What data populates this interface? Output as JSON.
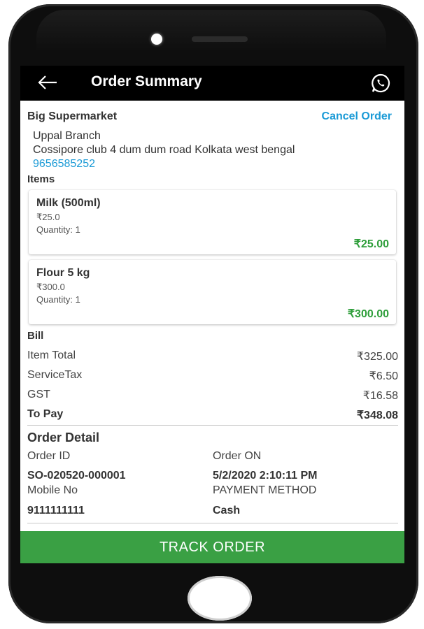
{
  "appbar": {
    "title": "Order Summary"
  },
  "store": {
    "name": "Big Supermarket",
    "cancel_label": "Cancel Order",
    "branch": "Uppal Branch",
    "address": "Cossipore club 4 dum dum road Kolkata west bengal",
    "phone": "9656585252"
  },
  "items_title": "Items",
  "items": [
    {
      "name": "Milk (500ml)",
      "price": "₹25.0",
      "quantity": "Quantity: 1",
      "total": "₹25.00"
    },
    {
      "name": "Flour 5 kg",
      "price": "₹300.0",
      "quantity": "Quantity: 1",
      "total": "₹300.00"
    }
  ],
  "bill": {
    "title": "Bill",
    "rows": [
      {
        "label": "Item Total",
        "value": "₹325.00"
      },
      {
        "label": "ServiceTax",
        "value": "₹6.50"
      },
      {
        "label": "GST",
        "value": "₹16.58"
      },
      {
        "label": "To Pay",
        "value": "₹348.08"
      }
    ]
  },
  "order_detail": {
    "title": "Order Detail",
    "order_id_label": "Order ID",
    "order_id": "SO-020520-000001",
    "order_on_label": "Order ON",
    "order_on": "5/2/2020 2:10:11 PM",
    "mobile_label": "Mobile No",
    "mobile": "9111111111",
    "payment_label": "PAYMENT METHOD",
    "payment": "Cash"
  },
  "track_label": "TRACK ORDER",
  "colors": {
    "accent_blue": "#1a9ad6",
    "price_green": "#2e9e3a",
    "button_green": "#3aa044"
  },
  "icons": {
    "back": "arrow-left-icon",
    "share": "whatsapp-icon"
  }
}
